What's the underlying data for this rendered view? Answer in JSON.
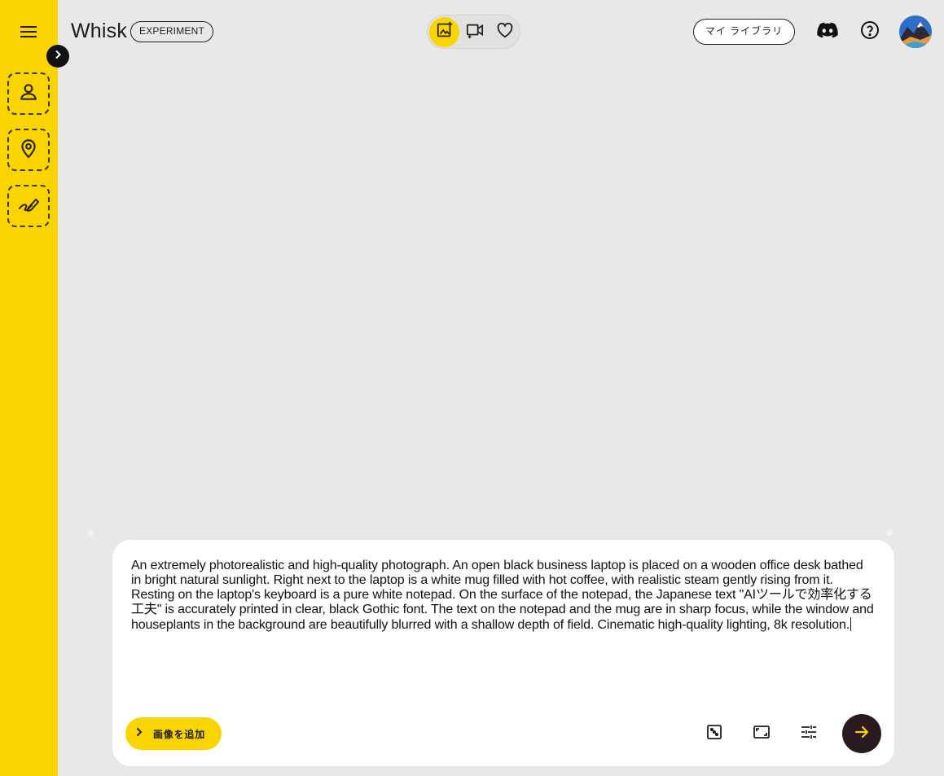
{
  "app": {
    "title": "Whisk",
    "badge": "EXPERIMENT"
  },
  "sidebar": {
    "menu_icon": "hamburger-menu-icon",
    "expand_icon": "chevron-right-icon",
    "slots": [
      {
        "name": "subject-slot",
        "icon": "person-icon"
      },
      {
        "name": "scene-slot",
        "icon": "location-pin-icon"
      },
      {
        "name": "style-slot",
        "icon": "brush-icon"
      }
    ]
  },
  "mode_switch": {
    "modes": [
      {
        "name": "image",
        "icon": "image-add-icon",
        "active": true
      },
      {
        "name": "video",
        "icon": "video-spark-icon",
        "active": false
      },
      {
        "name": "favorites",
        "icon": "heart-icon",
        "active": false
      }
    ]
  },
  "header": {
    "library_label": "マイ ライブラリ",
    "discord_icon": "discord-icon",
    "help_icon": "help-icon",
    "avatar_icon": "avatar"
  },
  "prompt": {
    "text": "An extremely photorealistic and high-quality photograph. An open black business laptop is placed on a wooden office desk bathed in bright natural sunlight. Right next to the laptop is a white mug filled with hot coffee, with realistic steam gently rising from it. Resting on the laptop's keyboard is a pure white notepad. On the surface of the notepad, the Japanese text \"AIツールで効率化する工夫\" is accurately printed in clear, black Gothic font. The text on the notepad and the mug are in sharp focus, while the window and houseplants in the background are beautifully blurred with a shallow depth of field. Cinematic high-quality lighting, 8k resolution.",
    "add_image_label": "画像を追加",
    "tools": [
      {
        "name": "random-dice",
        "icon": "dice-icon"
      },
      {
        "name": "aspect-ratio",
        "icon": "aspect-ratio-icon"
      },
      {
        "name": "settings",
        "icon": "tune-icon"
      }
    ],
    "send_icon": "arrow-right-icon"
  },
  "colors": {
    "accent": "#fad400",
    "background": "#e8e8e8",
    "send_button": "#2a1a1f",
    "send_arrow": "#fad400"
  }
}
